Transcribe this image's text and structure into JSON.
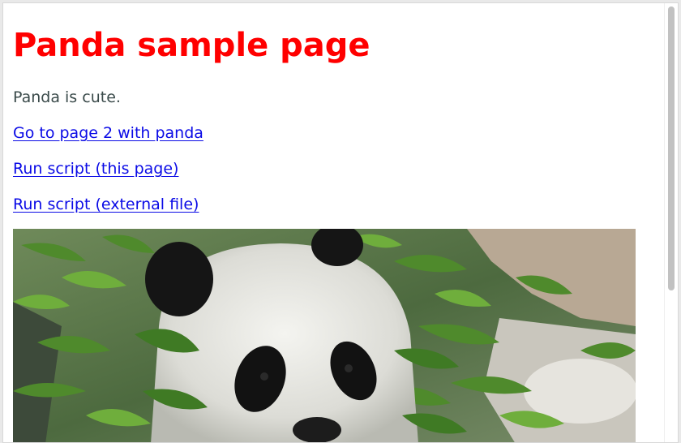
{
  "page": {
    "title": "Panda sample page",
    "description": "Panda is cute.",
    "links": [
      {
        "label": "Go to page 2 with panda"
      },
      {
        "label": "Run script (this page)"
      },
      {
        "label": "Run script (external file)"
      }
    ]
  },
  "colors": {
    "title": "#ff0000",
    "link": "#0a0ae6",
    "text": "#3a4a4a"
  },
  "image": {
    "subject": "giant panda among bamboo leaves",
    "icon": "panda-photo"
  }
}
